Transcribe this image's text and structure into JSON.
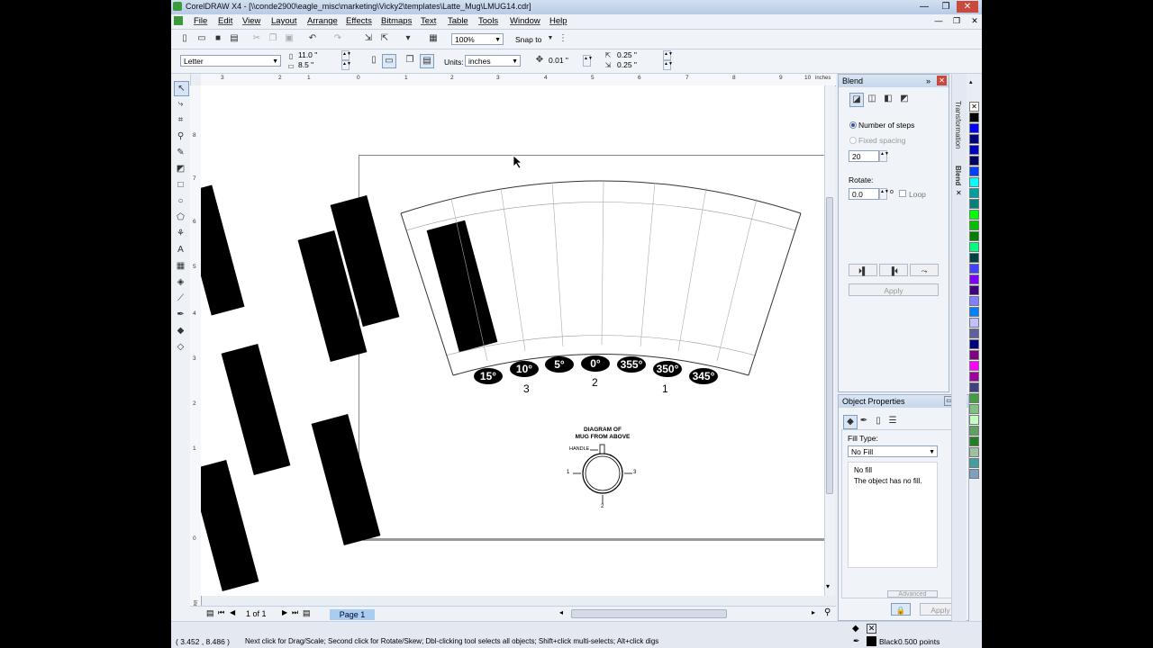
{
  "window": {
    "title": "CorelDRAW X4 - [\\\\conde2900\\eagle_misc\\marketing\\Vicky2\\templates\\Latte_Mug\\LMUG14.cdr]"
  },
  "menu": [
    "File",
    "Edit",
    "View",
    "Layout",
    "Arrange",
    "Effects",
    "Bitmaps",
    "Text",
    "Table",
    "Tools",
    "Window",
    "Help"
  ],
  "standard": {
    "zoom": "100%",
    "snap_label": "Snap to"
  },
  "property_bar": {
    "page_size": "Letter",
    "width": "11.0 \"",
    "height": "8.5 \"",
    "units_label": "Units:",
    "units": "inches",
    "nudge": "0.01 \"",
    "dup_x": "0.25 \"",
    "dup_y": "0.25 \""
  },
  "ruler": {
    "h_labels": [
      "3",
      "2",
      "1",
      "0",
      "1",
      "2",
      "3",
      "4",
      "5",
      "6",
      "7",
      "8",
      "9",
      "10"
    ],
    "h_unit": "inches",
    "v_labels": [
      "8",
      "7",
      "6",
      "5",
      "4",
      "3",
      "2",
      "1",
      "0"
    ],
    "v_unit": "inches"
  },
  "canvas": {
    "degree_labels": [
      "15°",
      "10°",
      "5°",
      "0°",
      "355°",
      "350°",
      "345°"
    ],
    "handle_numbers": [
      "3",
      "2",
      "1"
    ],
    "diagram_title_1": "DIAGRAM OF",
    "diagram_title_2": "MUG FROM ABOVE",
    "handle_label": "HANDLE",
    "pos1": "1",
    "pos2": "2",
    "pos3": "3"
  },
  "page_nav": {
    "counter": "1 of 1",
    "page_tab": "Page 1"
  },
  "blend_docker": {
    "title": "Blend",
    "number_of_steps_label": "Number of steps",
    "fixed_spacing_label": "Fixed spacing",
    "steps_value": "20",
    "rotate_label": "Rotate:",
    "rotate_value": "0.0",
    "rotate_unit": "o",
    "loop_label": "Loop",
    "apply_label": "Apply"
  },
  "object_properties": {
    "title": "Object Properties",
    "fill_type_label": "Fill Type:",
    "fill_type_value": "No Fill",
    "desc_title": "No fill",
    "desc_text": "The object has no fill.",
    "advanced_label": "Advanced",
    "apply_label": "Apply"
  },
  "side_tabs": {
    "transformation": "Transformation",
    "blend": "Blend"
  },
  "status": {
    "coords": "( 3.452 , 8.486 )",
    "hint": "Next click for Drag/Scale; Second click for Rotate/Skew; Dbl-clicking tool selects all objects; Shift+click multi-selects; Alt+click digs",
    "outline_label": "Black",
    "outline_width": "0.500 points"
  },
  "palette_colors": [
    "#ffffff",
    "#000000",
    "#0000ff",
    "#00007f",
    "#0000bf",
    "#000060",
    "#0040ff",
    "#00ffff",
    "#00a0a0",
    "#008080",
    "#00ff00",
    "#00c000",
    "#008000",
    "#00ff80",
    "#004040",
    "#4040ff",
    "#8000ff",
    "#400080",
    "#8080ff",
    "#0080ff",
    "#c0c0ff",
    "#6060a0",
    "#000080",
    "#800080",
    "#ff00ff",
    "#a000a0",
    "#404080",
    "#40a040",
    "#80c080",
    "#c0ffc0",
    "#60a060",
    "#208020",
    "#a0c0a0",
    "#40a0a0",
    "#80a0c0"
  ]
}
